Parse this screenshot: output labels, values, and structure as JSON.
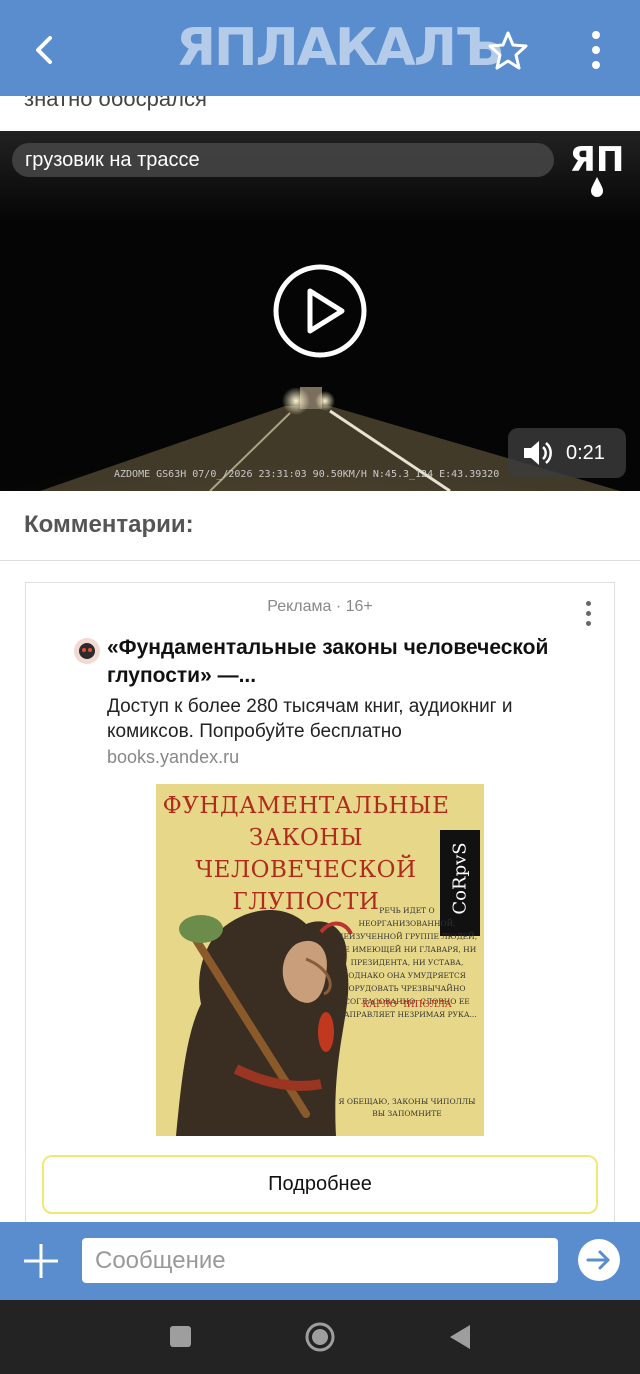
{
  "header": {
    "back_icon": "arrow-left-icon",
    "logo_text": "ЯПЛАКАЛЪ",
    "favorite_icon": "star-outline-icon",
    "menu_icon": "more-vertical-icon",
    "color": "#5a8dce"
  },
  "post": {
    "tail_text": "знатно обосрался"
  },
  "video": {
    "title": "грузовик на трассе",
    "watermark_text": "ЯП",
    "play_icon": "play-circle-icon",
    "volume_icon": "volume-icon",
    "duration": "0:21",
    "dashcam_stamp": "AZDOME GS63H 07/0_/2026 23:31:03     90.50KM/H N:45.3_124 E:43.39320"
  },
  "comments": {
    "heading": "Комментарии:"
  },
  "ad": {
    "label": "Реклама · 16+",
    "menu_icon": "more-vertical-icon",
    "headline": "«Фундаментальные законы человеческой глупости» —...",
    "description": "Доступ к более 280 тысячам книг, аудиокниг и комиксов. Попробуйте бесплатно",
    "domain": "books.yandex.ru",
    "book": {
      "title": "ФУНДАМЕНТАЛЬНЫЕ ЗАКОНЫ ЧЕЛОВЕЧЕСКОЙ ГЛУПОСТИ",
      "publisher": "CoRpvS",
      "blurb": "РЕЧЬ ИДЕТ О НЕОРГАНИЗОВАННОЙ, НЕИЗУЧЕННОЙ ГРУППЕ ЛЮДЕЙ, НЕ ИМЕЮЩЕЙ НИ ГЛАВАРЯ, НИ ПРЕЗИДЕНТА, НИ УСТАВА, ОДНАКО ОНА УМУДРЯЕТСЯ ОРУДОВАТЬ ЧРЕЗВЫЧАЙНО СОГЛАСОВАННО, СЛОВНО ЕЕ НАПРАВЛЯЕТ НЕЗРИМАЯ РУКА...",
      "author": "КАРЛО ЧИПОЛЛА",
      "blurb2": "Я ОБЕЩАЮ, ЗАКОНЫ ЧИПОЛЛЫ ВЫ ЗАПОМНИТЕ"
    },
    "button_label": "Подробнее"
  },
  "composer": {
    "attach_icon": "plus-icon",
    "placeholder": "Сообщение",
    "send_icon": "arrow-right-icon"
  },
  "system_nav": {
    "recent_icon": "square-icon",
    "home_icon": "circle-icon",
    "back_icon": "triangle-back-icon"
  }
}
